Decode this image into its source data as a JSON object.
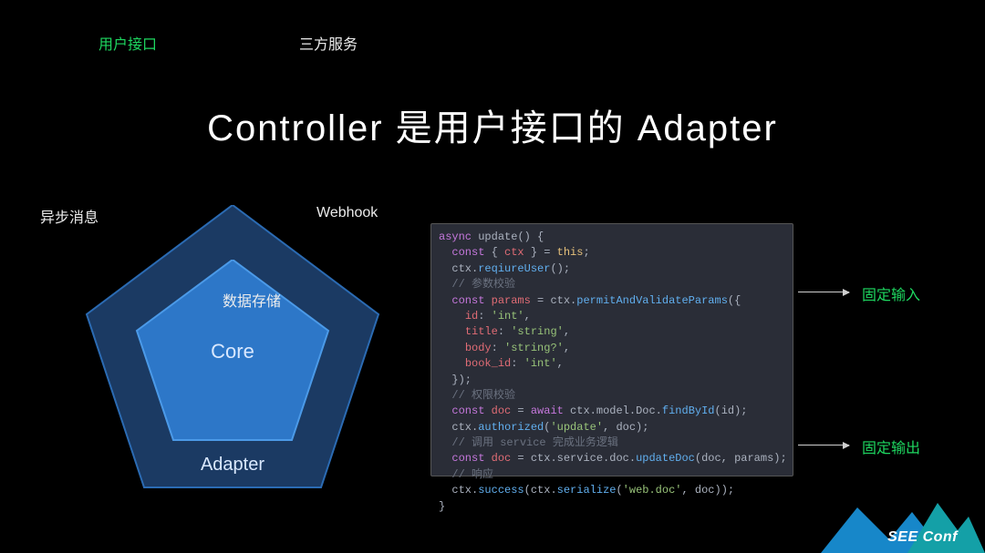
{
  "title": "Controller 是用户接口的 Adapter",
  "diagram": {
    "core": "Core",
    "adapter": "Adapter",
    "labels": {
      "user_interface": "用户接口",
      "third_party": "三方服务",
      "async_msg": "异步消息",
      "webhook": "Webhook",
      "data_store": "数据存储"
    }
  },
  "code_lines": [
    [
      [
        "kw",
        "async"
      ],
      [
        "id",
        " update"
      ],
      [
        "punc",
        "() {"
      ]
    ],
    [
      [
        "id",
        "  "
      ],
      [
        "kw",
        "const"
      ],
      [
        "id",
        " { "
      ],
      [
        "prop",
        "ctx"
      ],
      [
        "id",
        " } = "
      ],
      [
        "this",
        "this"
      ],
      [
        "punc",
        ";"
      ]
    ],
    [
      [
        "id",
        "  ctx."
      ],
      [
        "fn",
        "reqiureUser"
      ],
      [
        "punc",
        "();"
      ]
    ],
    [
      [
        "id",
        "  "
      ],
      [
        "cmt",
        "// 参数校验"
      ]
    ],
    [
      [
        "id",
        "  "
      ],
      [
        "kw",
        "const"
      ],
      [
        "id",
        " "
      ],
      [
        "prop",
        "params"
      ],
      [
        "id",
        " = ctx."
      ],
      [
        "fn",
        "permitAndValidateParams"
      ],
      [
        "punc",
        "({"
      ]
    ],
    [
      [
        "id",
        "    "
      ],
      [
        "prop",
        "id"
      ],
      [
        "punc",
        ": "
      ],
      [
        "str",
        "'int'"
      ],
      [
        "punc",
        ","
      ]
    ],
    [
      [
        "id",
        "    "
      ],
      [
        "prop",
        "title"
      ],
      [
        "punc",
        ": "
      ],
      [
        "str",
        "'string'"
      ],
      [
        "punc",
        ","
      ]
    ],
    [
      [
        "id",
        "    "
      ],
      [
        "prop",
        "body"
      ],
      [
        "punc",
        ": "
      ],
      [
        "str",
        "'string?'"
      ],
      [
        "punc",
        ","
      ]
    ],
    [
      [
        "id",
        "    "
      ],
      [
        "prop",
        "book_id"
      ],
      [
        "punc",
        ": "
      ],
      [
        "str",
        "'int'"
      ],
      [
        "punc",
        ","
      ]
    ],
    [
      [
        "id",
        "  "
      ],
      [
        "punc",
        "});"
      ]
    ],
    [
      [
        "id",
        "  "
      ],
      [
        "cmt",
        "// 权限校验"
      ]
    ],
    [
      [
        "id",
        "  "
      ],
      [
        "kw",
        "const"
      ],
      [
        "id",
        " "
      ],
      [
        "prop",
        "doc"
      ],
      [
        "id",
        " = "
      ],
      [
        "kw",
        "await"
      ],
      [
        "id",
        " ctx.model.Doc."
      ],
      [
        "fn",
        "findById"
      ],
      [
        "punc",
        "(id);"
      ]
    ],
    [
      [
        "id",
        "  ctx."
      ],
      [
        "fn",
        "authorized"
      ],
      [
        "punc",
        "("
      ],
      [
        "str",
        "'update'"
      ],
      [
        "punc",
        ", doc);"
      ]
    ],
    [
      [
        "id",
        "  "
      ],
      [
        "cmt",
        "// 调用 service 完成业务逻辑"
      ]
    ],
    [
      [
        "id",
        "  "
      ],
      [
        "kw",
        "const"
      ],
      [
        "id",
        " "
      ],
      [
        "prop",
        "doc"
      ],
      [
        "id",
        " = ctx.service.doc."
      ],
      [
        "fn",
        "updateDoc"
      ],
      [
        "punc",
        "(doc, params);"
      ]
    ],
    [
      [
        "id",
        "  "
      ],
      [
        "cmt",
        "// 响应"
      ]
    ],
    [
      [
        "id",
        "  ctx."
      ],
      [
        "fn",
        "success"
      ],
      [
        "punc",
        "(ctx."
      ],
      [
        "fn",
        "serialize"
      ],
      [
        "punc",
        "("
      ],
      [
        "str",
        "'web.doc'"
      ],
      [
        "punc",
        ", doc));"
      ]
    ],
    [
      [
        "punc",
        "}"
      ]
    ]
  ],
  "outputs": {
    "fixed_input": "固定输入",
    "fixed_output": "固定输出"
  },
  "footer": {
    "brand": "SEE Conf"
  },
  "colors": {
    "penta_outer_fill": "#1b3a63",
    "penta_outer_stroke": "#2b6bb3",
    "penta_inner_fill": "#2d77c8",
    "penta_inner_stroke": "#4b9ae8",
    "accent_green": "#1ed760"
  }
}
